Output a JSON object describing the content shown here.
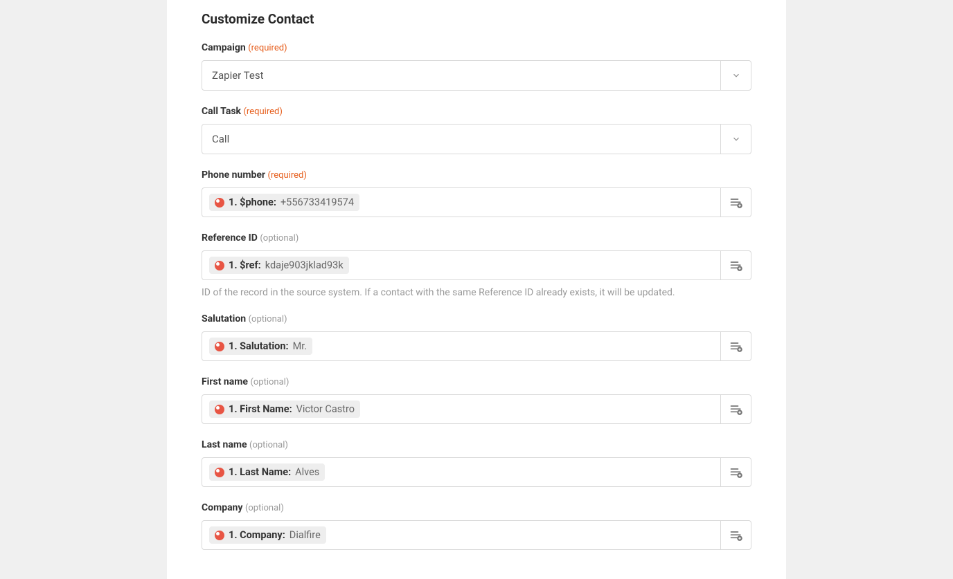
{
  "section_title": "Customize Contact",
  "labels": {
    "required": "(required)",
    "optional": "(optional)"
  },
  "help": {
    "reference_id": "ID of the record in the source system. If a contact with the same Reference ID already exists, it will be updated."
  },
  "fields": {
    "campaign": {
      "label": "Campaign",
      "value": "Zapier Test"
    },
    "call_task": {
      "label": "Call Task",
      "value": "Call"
    },
    "phone": {
      "label": "Phone number",
      "pill_key": "1. $phone:",
      "pill_val": "+556733419574"
    },
    "reference_id": {
      "label": "Reference ID",
      "pill_key": "1. $ref:",
      "pill_val": "kdaje903jklad93k"
    },
    "salutation": {
      "label": "Salutation",
      "pill_key": "1. Salutation:",
      "pill_val": "Mr."
    },
    "first_name": {
      "label": "First name",
      "pill_key": "1. First Name:",
      "pill_val": "Victor Castro"
    },
    "last_name": {
      "label": "Last name",
      "pill_key": "1. Last Name:",
      "pill_val": "Alves"
    },
    "company": {
      "label": "Company",
      "pill_key": "1. Company:",
      "pill_val": "Dialfire"
    }
  }
}
